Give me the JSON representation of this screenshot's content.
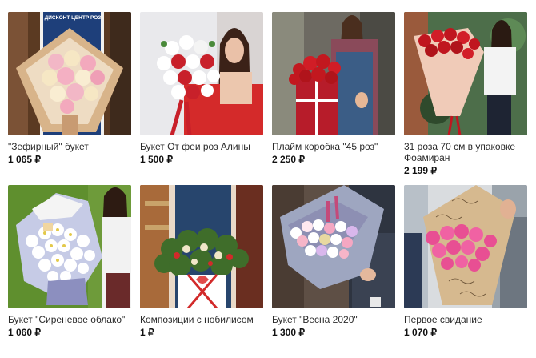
{
  "products": [
    {
      "title": "\"Зефирный\" букет",
      "price": "1 065 ₽",
      "image": "pastel-roses-bouquet"
    },
    {
      "title": "Букет От феи роз Алины",
      "price": "1 500 ₽",
      "image": "red-white-roses-bouquet"
    },
    {
      "title": "Плайм коробка \"45 роз\"",
      "price": "2 250 ₽",
      "image": "red-roses-box"
    },
    {
      "title": "31 роза 70 см в упаковке Фоамиран",
      "price": "2 199 ₽",
      "image": "long-red-roses-bouquet"
    },
    {
      "title": "Букет \"Сиреневое облако\"",
      "price": "1 060 ₽",
      "image": "white-chrysanthemums-bouquet"
    },
    {
      "title": "Композиции с нобилисом",
      "price": "1 ₽",
      "image": "nobilis-composition"
    },
    {
      "title": "Букет \"Весна 2020\"",
      "price": "1 300 ₽",
      "image": "spring-mix-bouquet"
    },
    {
      "title": "Первое свидание",
      "price": "1 070 ₽",
      "image": "pink-roses-bouquet"
    }
  ],
  "apron_label": "ДИСКОНТ ЦЕНТР РОЗ",
  "colors": {
    "accent": "#e0245e",
    "text": "#2b2b2b"
  }
}
